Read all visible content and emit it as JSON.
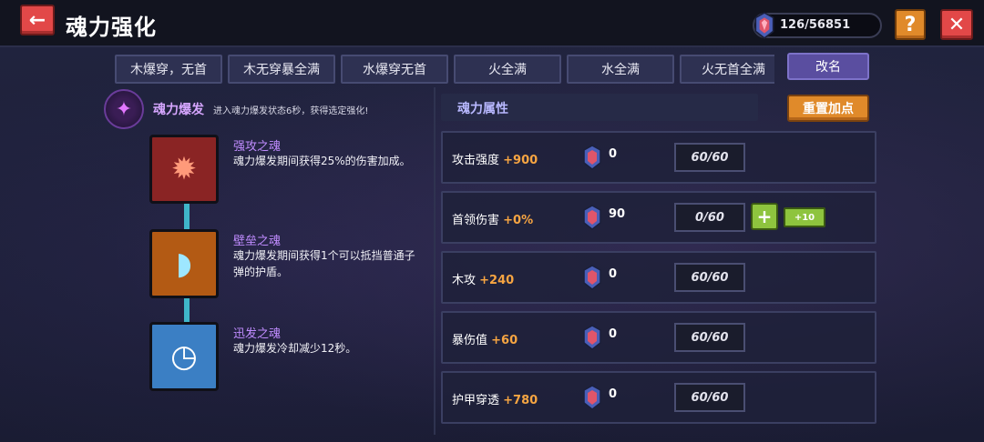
{
  "header": {
    "back_icon": "←",
    "title": "魂力强化",
    "currency": "126/56851",
    "help_label": "?",
    "close_label": "✕"
  },
  "tabs": [
    {
      "label": "木爆穿，无首"
    },
    {
      "label": "木无穿暴全满"
    },
    {
      "label": "水爆穿无首"
    },
    {
      "label": "火全满"
    },
    {
      "label": "水全满"
    },
    {
      "label": "火无首全满"
    }
  ],
  "rename_label": "改名",
  "burst": {
    "name": "魂力爆发",
    "desc": "进入魂力爆发状态6秒，获得选定强化!"
  },
  "souls": [
    {
      "name": "强攻之魂",
      "desc": "魂力爆发期间获得25%的伤害加成。"
    },
    {
      "name": "壁垒之魂",
      "desc": "魂力爆发期间获得1个可以抵挡普通子弹的护盾。"
    },
    {
      "name": "迅发之魂",
      "desc": "魂力爆发冷却减少12秒。"
    }
  ],
  "attributes": {
    "header": "魂力属性",
    "reset_label": "重置加点",
    "rows": [
      {
        "label": "攻击强度",
        "bonus": "+900",
        "cost": "0",
        "level": "60/60"
      },
      {
        "label": "首领伤害",
        "bonus": "+0%",
        "cost": "90",
        "level": "0/60",
        "plus": "+",
        "plus10": "+10"
      },
      {
        "label": "木攻",
        "bonus": "+240",
        "cost": "0",
        "level": "60/60"
      },
      {
        "label": "暴伤值",
        "bonus": "+60",
        "cost": "0",
        "level": "60/60"
      },
      {
        "label": "护甲穿透",
        "bonus": "+780",
        "cost": "0",
        "level": "60/60"
      }
    ]
  },
  "colors": {
    "accent_orange": "#f7a542",
    "button_red": "#e24848",
    "button_green": "#8ec43e",
    "soul_name": "#c08cff"
  }
}
